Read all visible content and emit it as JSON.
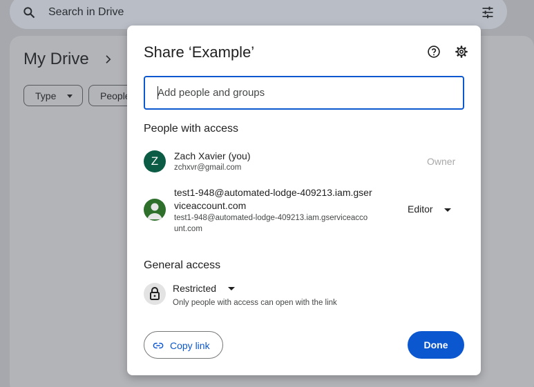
{
  "background": {
    "search_placeholder": "Search in Drive",
    "page_title": "My Drive",
    "filters": [
      "Type",
      "People"
    ]
  },
  "dialog": {
    "title": "Share ‘Example’",
    "add_placeholder": "Add people and groups",
    "people_section_title": "People with access",
    "people": [
      {
        "avatar_letter": "Z",
        "name": "Zach Xavier (you)",
        "email": "zchxvr@gmail.com",
        "role": "Owner"
      },
      {
        "name_line1": "test1-948@automated-lodge-409213.iam.gser",
        "name_line2": "viceaccount.com",
        "email_line1": "test1-948@automated-lodge-409213.iam.gserviceacco",
        "email_line2": "unt.com",
        "role": "Editor"
      }
    ],
    "general_access_title": "General access",
    "general_access": {
      "value": "Restricted",
      "description": "Only people with access can open with the link"
    },
    "copy_link_label": "Copy link",
    "done_label": "Done"
  },
  "colors": {
    "accent": "#0b57d0",
    "owner_avatar": "#0c5c45",
    "backdrop": "#a6a8ad"
  },
  "icons": [
    "search-icon",
    "tune-icon",
    "chevron-right-icon",
    "help-icon",
    "gear-icon",
    "person-icon",
    "lock-icon",
    "link-icon"
  ]
}
